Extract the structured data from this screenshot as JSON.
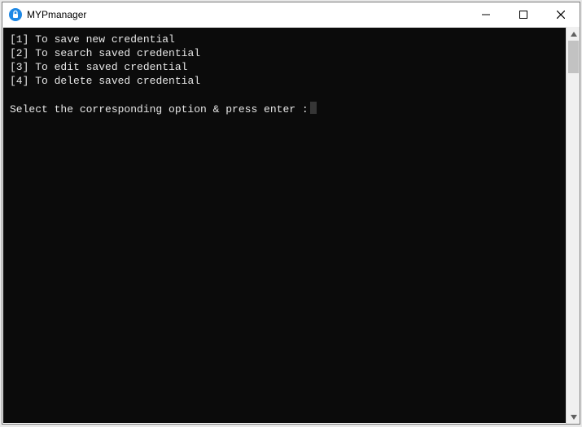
{
  "window": {
    "title": "MYPmanager"
  },
  "menu": [
    {
      "index": "[1]",
      "label": "To save new credential"
    },
    {
      "index": "[2]",
      "label": "To search saved credential"
    },
    {
      "index": "[3]",
      "label": "To edit saved credential"
    },
    {
      "index": "[4]",
      "label": "To delete saved credential"
    }
  ],
  "prompt": "Select the corresponding option & press enter :",
  "icons": {
    "minimize": "—",
    "maximize": "☐",
    "close": "✕",
    "up": "▴",
    "down": "▾"
  }
}
